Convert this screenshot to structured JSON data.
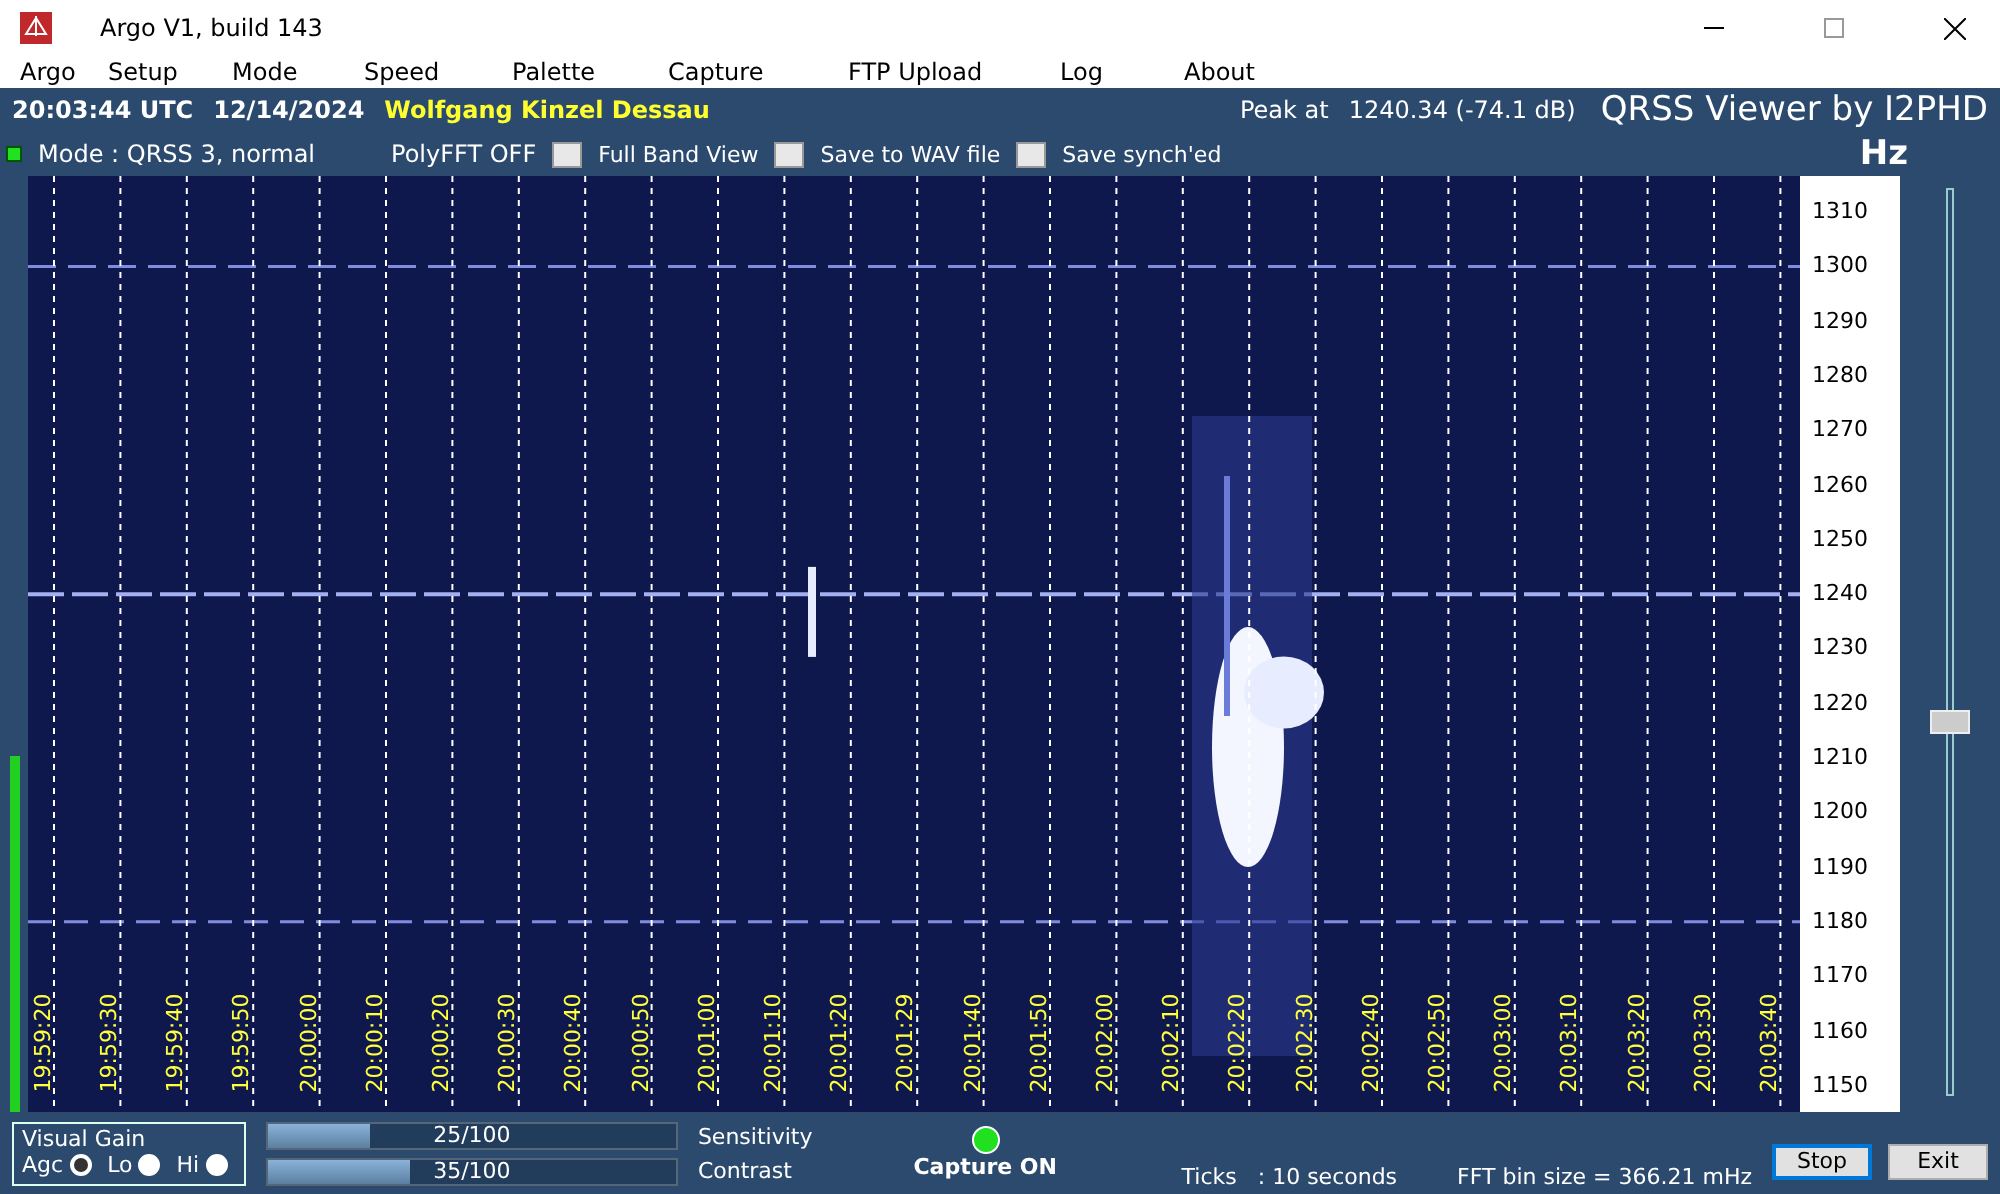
{
  "window": {
    "title": "Argo V1, build 143"
  },
  "menu": [
    "Argo",
    "Setup",
    "Mode",
    "Speed",
    "Palette",
    "Capture",
    "FTP Upload",
    "Log",
    "About"
  ],
  "header": {
    "time": "20:03:44 UTC",
    "date": "12/14/2024",
    "station": "Wolfgang Kinzel Dessau",
    "peak_label": "Peak at",
    "peak_value": "1240.34 (-74.1 dB)",
    "brand": "QRSS Viewer by I2PHD",
    "mode": "Mode : QRSS 3, normal",
    "polyfft": "PolyFFT OFF",
    "unit": "Hz",
    "running": true
  },
  "options": [
    {
      "label": "Full Band View",
      "checked": false
    },
    {
      "label": "Save to WAV file",
      "checked": false
    },
    {
      "label": "Save synch'ed",
      "checked": false
    }
  ],
  "signal_meter": {
    "level": 0.38
  },
  "time_labels": [
    "19:59:20",
    "19:59:30",
    "19:59:40",
    "19:59:50",
    "20:00:00",
    "20:00:10",
    "20:00:20",
    "20:00:30",
    "20:00:40",
    "20:00:50",
    "20:01:00",
    "20:01:10",
    "20:01:20",
    "20:01:29",
    "20:01:40",
    "20:01:50",
    "20:02:00",
    "20:02:10",
    "20:02:20",
    "20:02:30",
    "20:02:40",
    "20:02:50",
    "20:03:00",
    "20:03:10",
    "20:03:20",
    "20:03:30",
    "20:03:40"
  ],
  "frequency_labels": [
    "1310",
    "1300",
    "1290",
    "1280",
    "1270",
    "1260",
    "1250",
    "1240",
    "1230",
    "1220",
    "1210",
    "1200",
    "1190",
    "1180",
    "1170",
    "1160",
    "1150"
  ],
  "baseline_slider": {
    "level": 0.41
  },
  "visual_gain": {
    "title": "Visual Gain",
    "options": [
      {
        "label": "Agc",
        "selected": true
      },
      {
        "label": "Lo",
        "selected": false
      },
      {
        "label": "Hi",
        "selected": false
      }
    ]
  },
  "bars": [
    {
      "reading": "25/100",
      "level": 0.25,
      "label": "Sensitivity"
    },
    {
      "reading": "35/100",
      "level": 0.35,
      "label": "Contrast"
    }
  ],
  "capture": {
    "label": "Capture ON",
    "on": true
  },
  "ticks": "Ticks   : 10 seconds",
  "fft_bin": "FFT bin size = 366.21 mHz",
  "buttons": [
    {
      "label": "Stop",
      "selected": true
    },
    {
      "label": "Exit",
      "selected": false
    }
  ]
}
